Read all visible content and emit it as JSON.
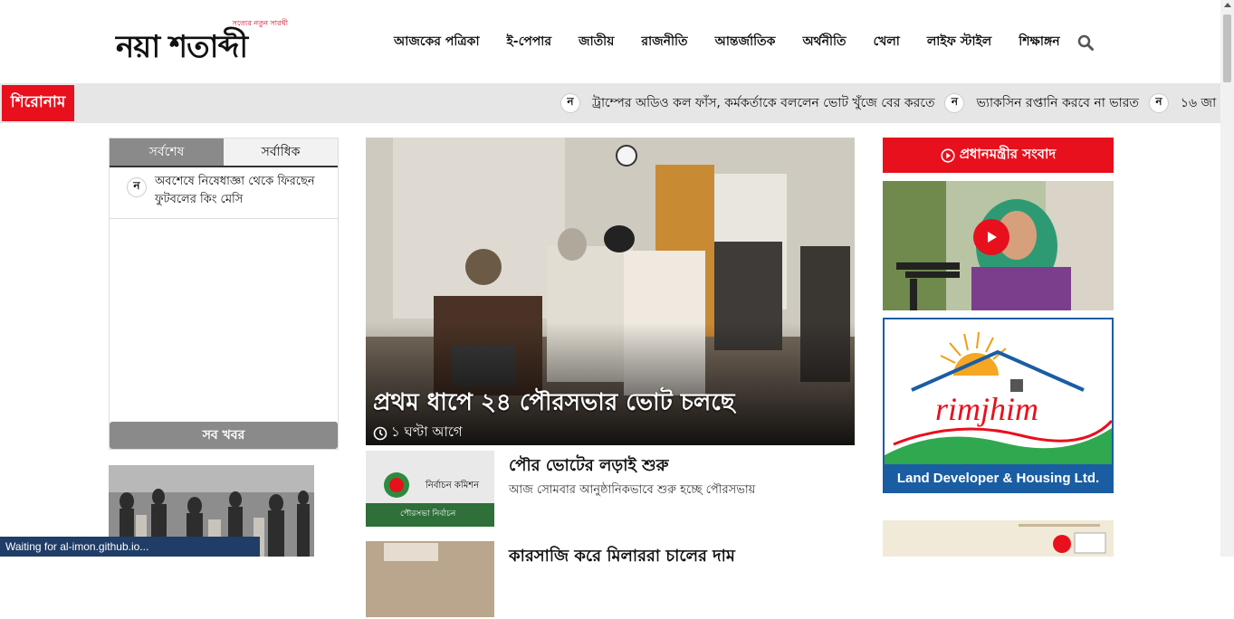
{
  "header": {
    "logo_text": "নয়া শতাব্দী",
    "logo_tagline": "সত্যের নতুন সারথী",
    "nav": [
      "আজকের পত্রিকা",
      "ই-পেপার",
      "জাতীয়",
      "রাজনীতি",
      "আন্তর্জাতিক",
      "অর্থনীতি",
      "খেলা",
      "লাইফ স্টাইল",
      "শিক্ষাঙ্গন"
    ]
  },
  "ticker": {
    "label": "শিরোনাম",
    "badge": "ন",
    "items": [
      "ট্রাম্পের অডিও কল ফাঁস, কর্মকর্তাকে বললেন ভোট খুঁজে বের করতে",
      "ভ্যাকসিন রপ্তানি করবে না ভারত",
      "১৬ জা"
    ]
  },
  "sidebar": {
    "tabs": [
      "সর্বশেষ",
      "সর্বাধিক"
    ],
    "latest": [
      {
        "badge": "ন",
        "text": "অবশেষে নিষেধাজ্ঞা থেকে ফিরছেন ফুটবলের কিং মেসি"
      }
    ],
    "all_news": "সব খবর"
  },
  "lead": {
    "headline": "প্রথম ধাপে ২৪ পৌরসভার ভোট চলছে",
    "time": "১ ঘণ্টা আগে"
  },
  "stories": [
    {
      "title": "পৌর ভোটের লড়াই শুরু",
      "desc": "আজ সোমবার আনুষ্ঠানিকভাবে শুরু হচ্ছে পৌরসভায়",
      "thumb_top": "নির্বাচন কমিশন",
      "thumb_bottom": "পৌরসভা নির্বাচন"
    },
    {
      "title": "কারসাজি করে মিলাররা চালের দাম",
      "desc": ""
    }
  ],
  "right": {
    "pm_button": "প্রধানমন্ত্রীর সংবাদ",
    "ad_brand": "rimjhim",
    "ad_tagline": "Land Developer & Housing Ltd."
  },
  "status": "Waiting for al-imon.github.io...",
  "colors": {
    "accent": "#e8101c",
    "ad_blue": "#1a5da3",
    "tab_gray": "#8a8a8a"
  }
}
